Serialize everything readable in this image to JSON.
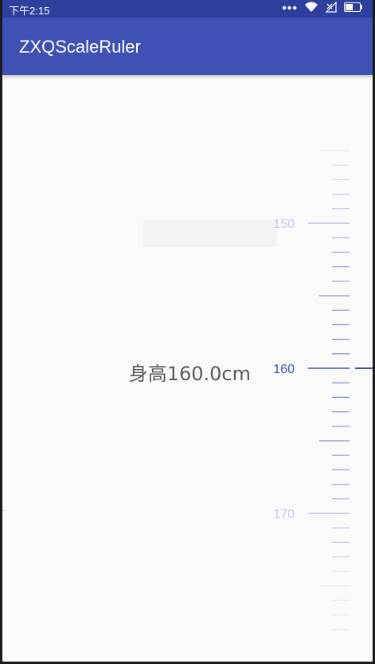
{
  "status_bar": {
    "time": "下午2:15",
    "icons": [
      "more-dots-icon",
      "wifi-icon",
      "no-signal-icon",
      "battery-icon"
    ]
  },
  "app_bar": {
    "title": "ZXQScaleRuler"
  },
  "ruler": {
    "current_value": 160.0,
    "min_visible": 145,
    "max_visible": 178,
    "major_step": 10,
    "mid_step": 5,
    "labels": [
      "150",
      "160",
      "170"
    ],
    "accent_color": "#3f51b5",
    "tick_color": "#c5cae9"
  },
  "height_display": {
    "text": "身高160.0cm"
  }
}
